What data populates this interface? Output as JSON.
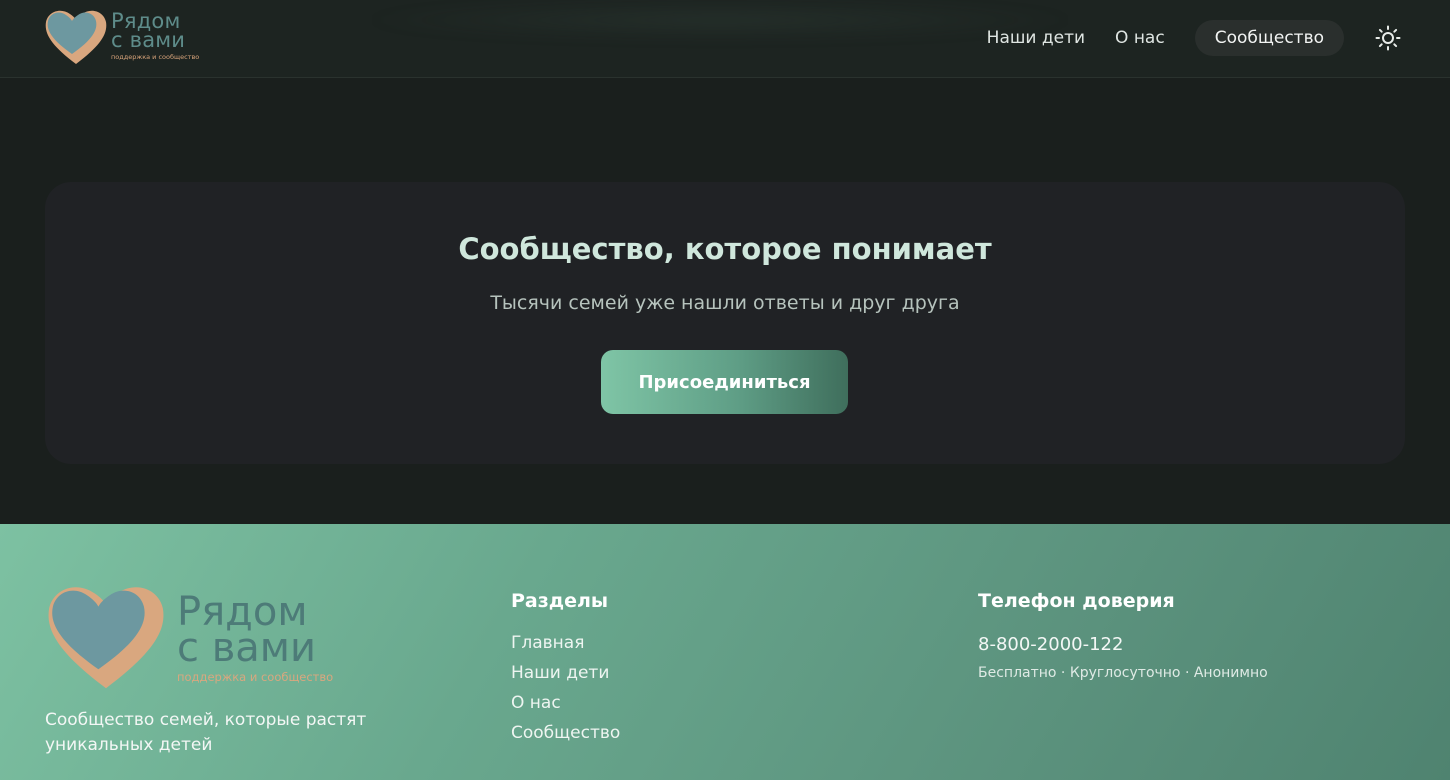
{
  "brand": {
    "name_line1": "Рядом",
    "name_line2": "с вами",
    "tagline": "поддержка и сообщество"
  },
  "nav": {
    "items": [
      {
        "label": "Наши дети"
      },
      {
        "label": "О нас"
      },
      {
        "label": "Сообщество",
        "active": true
      }
    ],
    "theme_toggle_icon": "sun-icon"
  },
  "hero": {
    "title": "Сообщество, которое понимает",
    "subtitle": "Тысячи семей уже нашли ответы и друг друга",
    "cta_label": "Присоединиться"
  },
  "footer": {
    "description": "Сообщество семей, которые растят уникальных детей",
    "sections_title": "Разделы",
    "sections": [
      "Главная",
      "Наши дети",
      "О нас",
      "Сообщество"
    ],
    "hotline_title": "Телефон доверия",
    "hotline_phone": "8-800-2000-122",
    "hotline_note": "Бесплатно · Круглосуточно · Анонимно"
  },
  "colors": {
    "accent": "#7fc5a6",
    "logo_heart_blue": "#6d98a0",
    "logo_heart_outline": "#d9a77f",
    "background": "#1a1f1d"
  }
}
